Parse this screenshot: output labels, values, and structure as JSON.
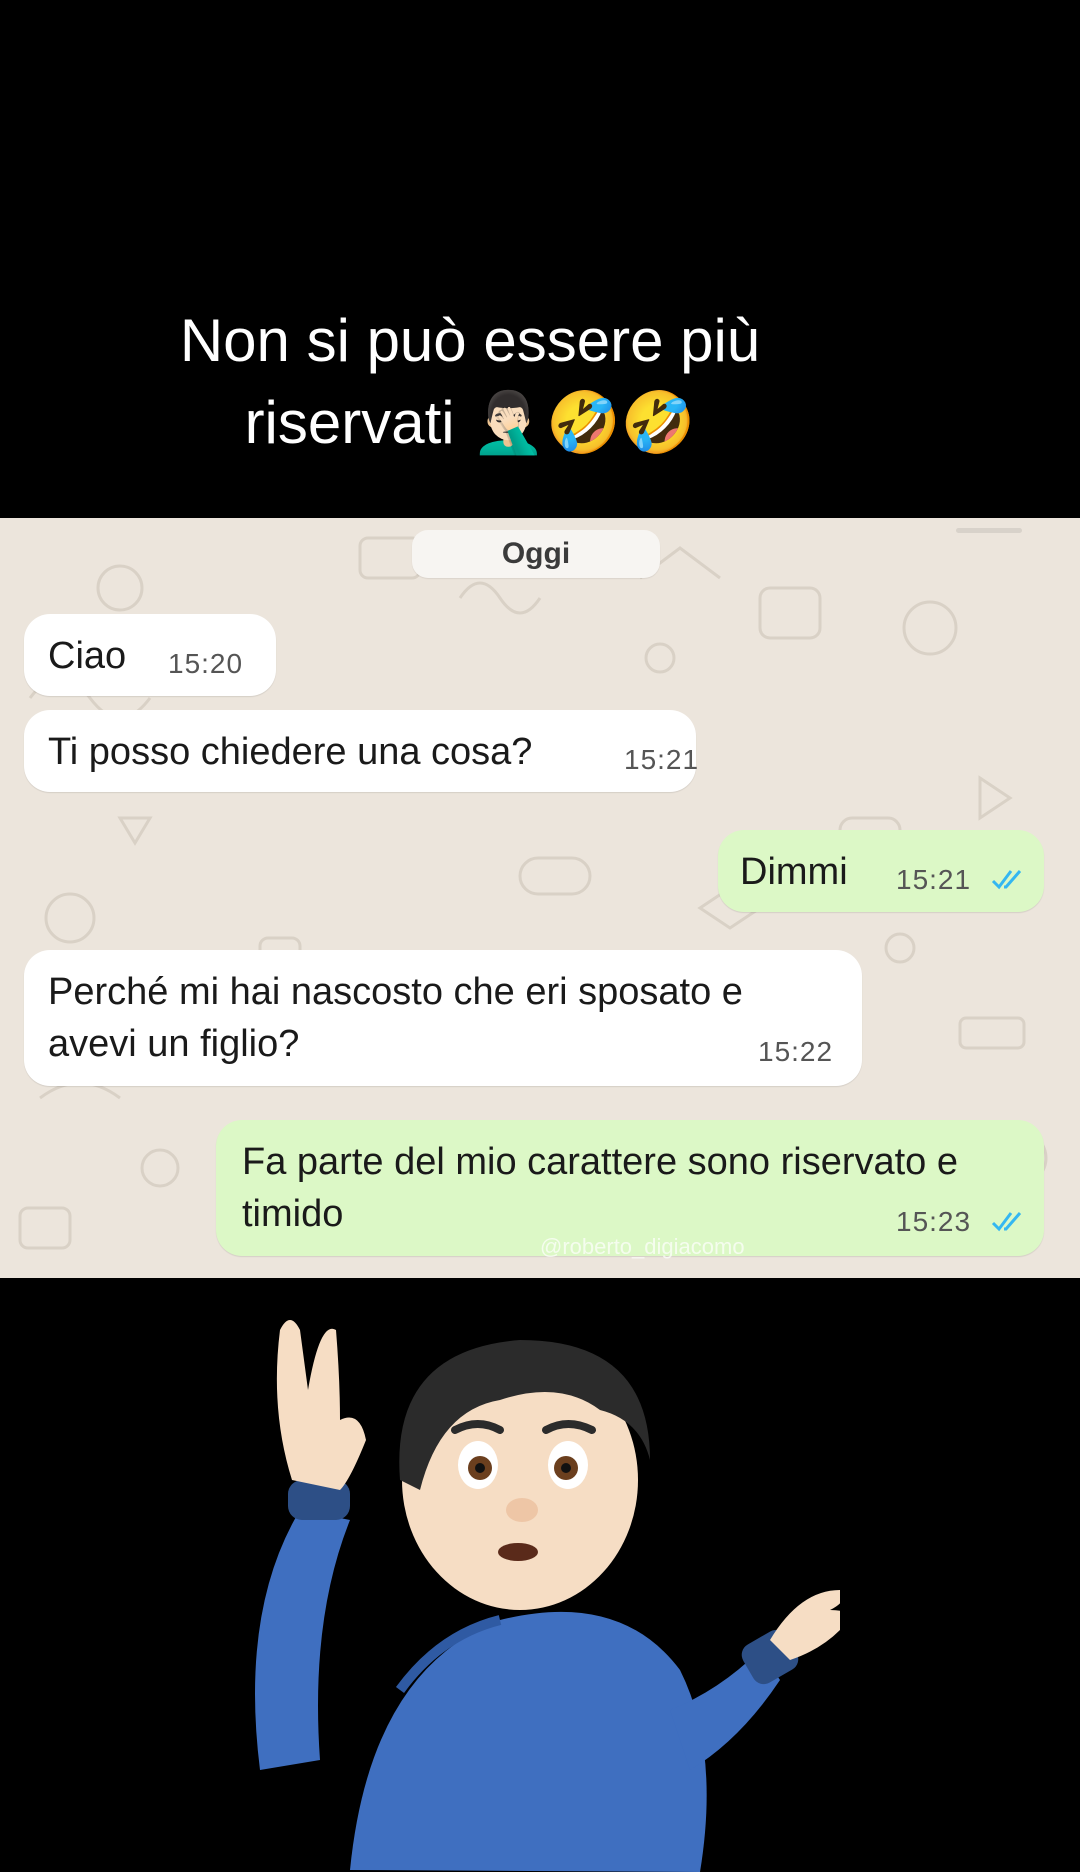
{
  "caption": {
    "line1": "Non si può essere più",
    "line2": "riservati 🤦🏻‍♂️🤣🤣"
  },
  "chat": {
    "date_label": "Oggi",
    "messages": [
      {
        "direction": "incoming",
        "text": "Ciao",
        "time": "15:20"
      },
      {
        "direction": "incoming",
        "text": "Ti posso chiedere una cosa?",
        "time": "15:21"
      },
      {
        "direction": "outgoing",
        "text": "Dimmi",
        "time": "15:21",
        "status": "read"
      },
      {
        "direction": "incoming",
        "text": "Perché mi hai nascosto che eri sposato e avevi un figlio?",
        "time": "15:22"
      },
      {
        "direction": "outgoing",
        "text": "Fa parte del mio carattere sono riservato e timido",
        "time": "15:23",
        "status": "read"
      }
    ],
    "watermark": "@roberto_digiacomo"
  },
  "overlay": {
    "icon": "person-shrugging-icon"
  },
  "colors": {
    "background": "#000000",
    "chat_wallpaper": "#ece5dc",
    "incoming_bubble": "#ffffff",
    "outgoing_bubble": "#dcf8c6",
    "read_ticks": "#34b7f1"
  }
}
